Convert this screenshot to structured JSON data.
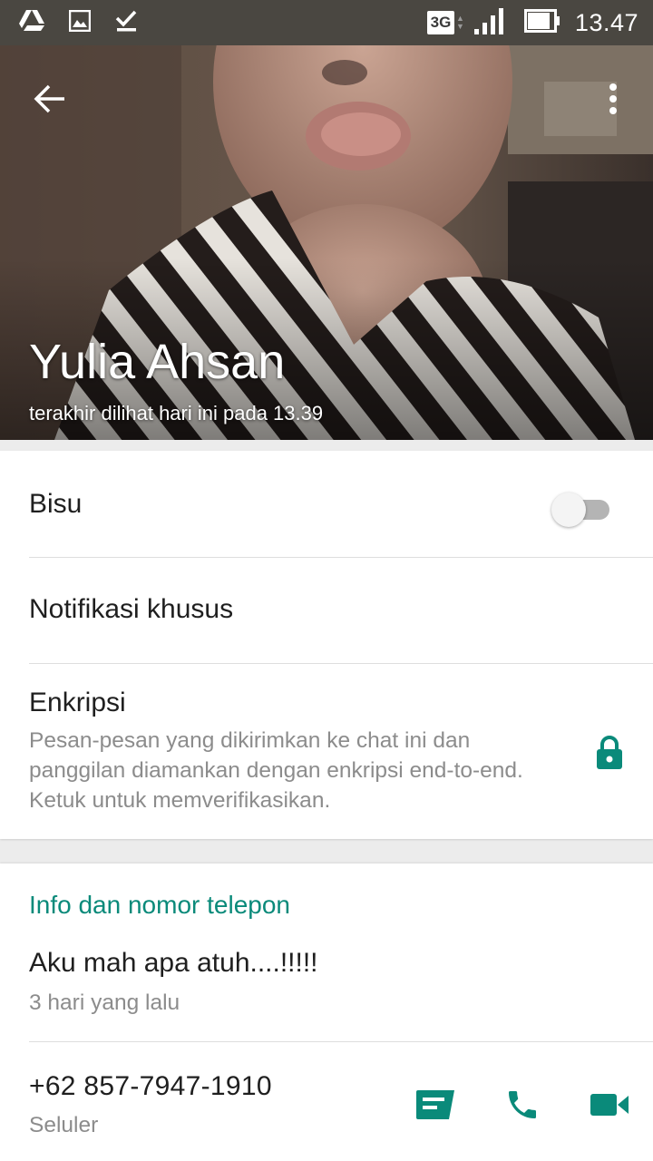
{
  "status_bar": {
    "network_type": "3G",
    "time": "13.47",
    "icons": [
      "drive-icon",
      "image-icon",
      "download-done-icon",
      "signal-icon",
      "battery-icon"
    ]
  },
  "header": {
    "contact_name": "Yulia Ahsan",
    "last_seen": "terakhir dilihat hari ini pada 13.39",
    "icons": [
      "back-arrow-icon",
      "more-vert-icon"
    ]
  },
  "settings": {
    "mute_label": "Bisu",
    "mute_enabled": false,
    "custom_notifications_label": "Notifikasi khusus",
    "encryption_label": "Enkripsi",
    "encryption_description": "Pesan-pesan yang dikirimkan ke chat ini dan panggilan diamankan dengan enkripsi end-to-end. Ketuk untuk memverifikasikan."
  },
  "info": {
    "section_title": "Info dan nomor telepon",
    "about_text": "Aku mah apa atuh....!!!!!",
    "about_date": "3 hari yang lalu",
    "phone_number": "+62 857-7947-1910",
    "phone_type": "Seluler",
    "actions": [
      "message-icon",
      "voice-call-icon",
      "video-call-icon"
    ]
  },
  "colors": {
    "accent": "#0a8a7a",
    "status_bar": "#4a4741",
    "toggle_off_track": "#b4b4b4"
  }
}
